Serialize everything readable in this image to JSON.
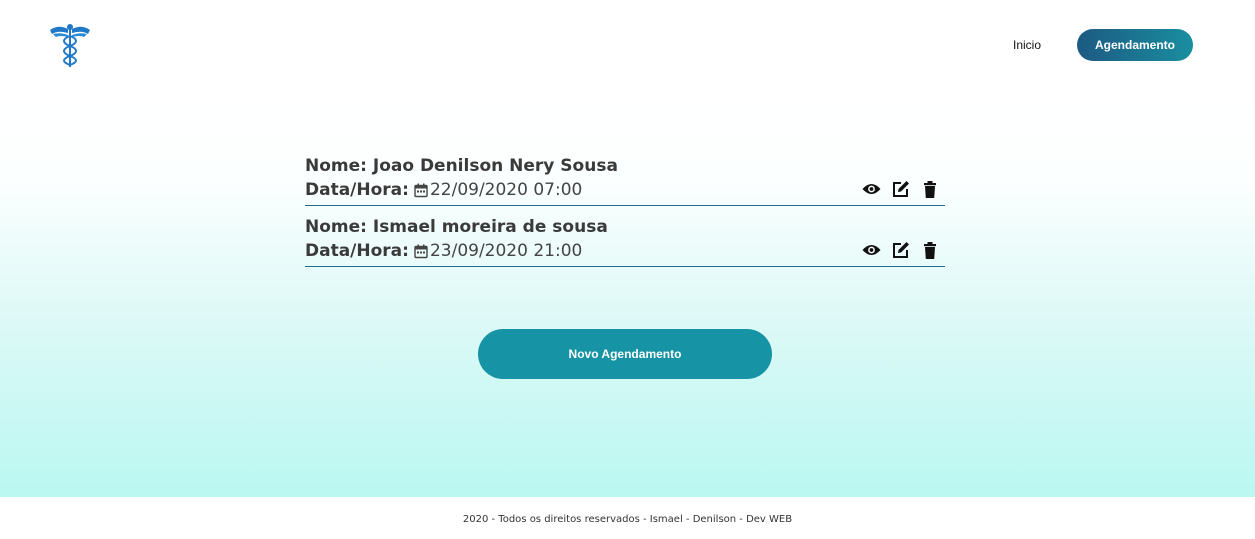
{
  "header": {
    "logo_icon": "caduceus-icon",
    "nav": {
      "home_label": "Inicio",
      "scheduling_label": "Agendamento"
    }
  },
  "appointments": [
    {
      "name_label": "Nome: Joao Denilson Nery Sousa",
      "date_label": "Data/Hora:",
      "date_value": "22/09/2020 07:00"
    },
    {
      "name_label": "Nome: Ismael moreira de sousa",
      "date_label": "Data/Hora:",
      "date_value": "23/09/2020 21:00"
    }
  ],
  "actions": {
    "icons": [
      "eye-icon",
      "edit-icon",
      "trash-icon"
    ]
  },
  "new_button_label": "Novo Agendamento",
  "footer": {
    "text": "2020 - Todos os direitos reservados - Ismael - Denilson - Dev WEB"
  },
  "colors": {
    "accent": "#1693a4",
    "nav_gradient_start": "#1c5a82",
    "nav_gradient_end": "#1a8ea0",
    "divider": "#1c6f8a"
  }
}
